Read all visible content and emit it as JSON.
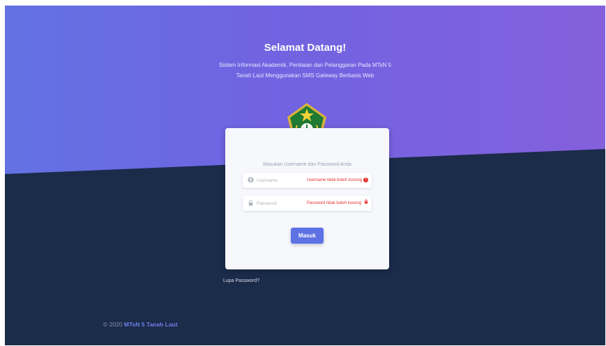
{
  "header": {
    "title": "Selamat Datang!",
    "subtitle": "Sistem Informasi Akademik, Penilaian dan Pelanggaran Pada MTsN 5 Tanah Laut Menggunakan SMS Gateway Berbasis Web"
  },
  "logo": {
    "icon": "kemenag-emblem-icon"
  },
  "login": {
    "prompt": "Masukan Username dan Password Anda",
    "username": {
      "placeholder": "Username",
      "value": "",
      "error": "Username tidak boleh kosong",
      "icon": "user-icon"
    },
    "password": {
      "placeholder": "Password",
      "value": "",
      "error": "Password tidak boleh kosong",
      "icon": "lock-icon"
    },
    "submit_label": "Masuk"
  },
  "links": {
    "forgot_password": "Lupa Password?"
  },
  "footer": {
    "copyright": "© 2020",
    "brand": "MTsN 5 Tanah Laut"
  },
  "colors": {
    "hero_start": "#6272e3",
    "hero_end": "#8460dc",
    "background": "#1b2b4a",
    "primary": "#5e72e4",
    "error": "#e53030"
  }
}
